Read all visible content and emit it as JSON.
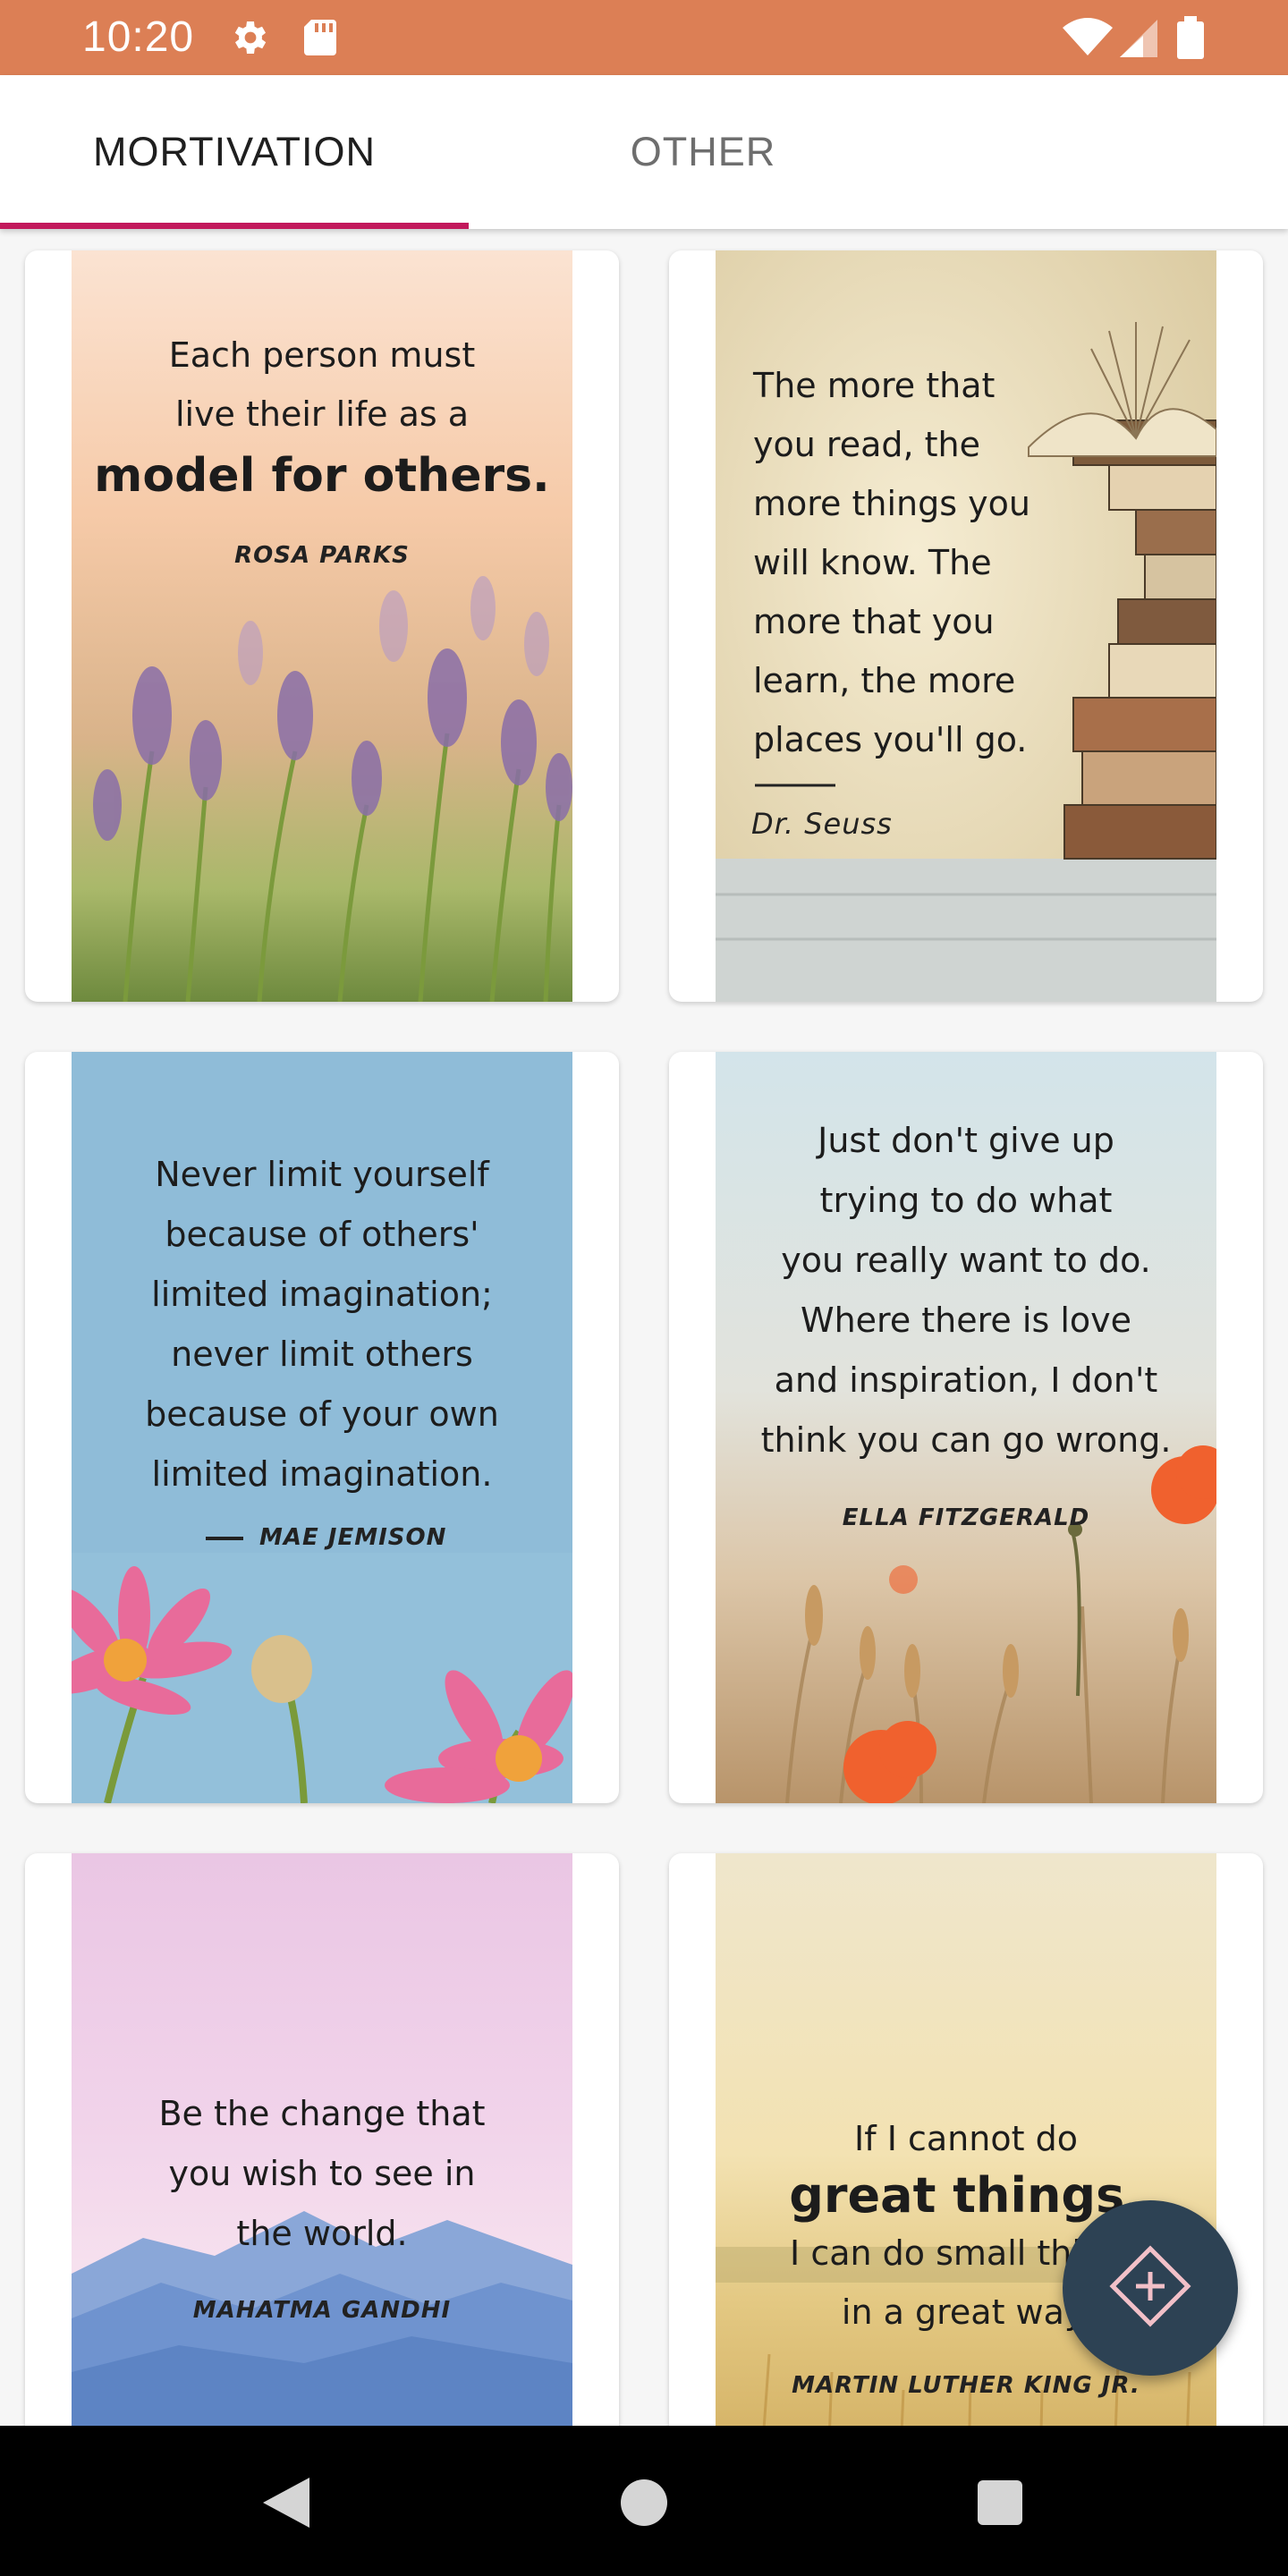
{
  "status_bar": {
    "time": "10:20",
    "icons": [
      "gear-icon",
      "sd-card-icon",
      "wifi-icon",
      "signal-icon",
      "battery-icon"
    ],
    "background": "#dc7f55"
  },
  "tabs": [
    {
      "label": "MORTIVATION",
      "active": true
    },
    {
      "label": "OTHER",
      "active": false
    }
  ],
  "accent_color": "#c2185b",
  "cards": [
    {
      "lines": [
        "Each person must",
        "live their life as a",
        "model for others."
      ],
      "author": "ROSA PARKS"
    },
    {
      "lines": [
        "The more that",
        "you read, the",
        "more things you",
        "will know. The",
        "more that you",
        "learn, the more",
        "places you'll go."
      ],
      "author": "Dr. Seuss"
    },
    {
      "lines": [
        "Never limit yourself",
        "because of others'",
        "limited imagination;",
        "never limit others",
        "because of your own",
        "limited imagination."
      ],
      "author": "MAE JEMISON"
    },
    {
      "lines": [
        "Just don't give up",
        "trying to do what",
        "you really want to do.",
        "Where there is love",
        "and inspiration, I don't",
        "think you can go wrong."
      ],
      "author": "ELLA FITZGERALD"
    },
    {
      "lines": [
        "Be the change that",
        "you wish to see in",
        "the world."
      ],
      "author": "MAHATMA GANDHI"
    },
    {
      "lines": [
        "If I cannot do",
        "great things,",
        "I can do small things",
        "in a great way."
      ],
      "author": "MARTIN LUTHER KING JR."
    }
  ],
  "fab": {
    "icon": "add-compass-icon",
    "color": "#2d4254"
  },
  "nav_bar": {
    "icons": [
      "back-icon",
      "home-icon",
      "recents-icon"
    ]
  }
}
